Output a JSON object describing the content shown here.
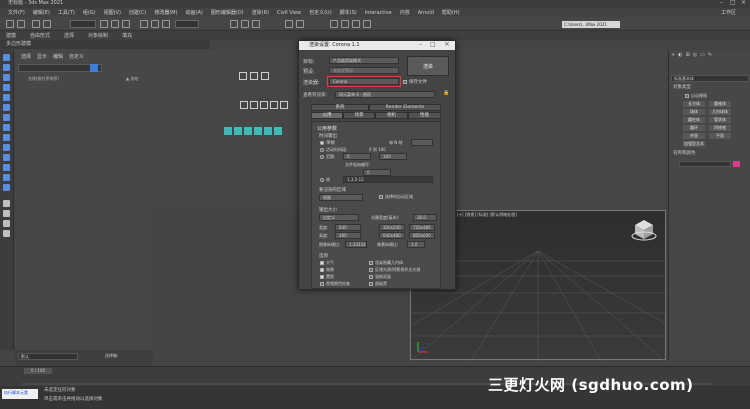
{
  "window": {
    "title": "无标题 - 3ds Max 2021"
  },
  "menu": [
    "文件(F)",
    "编辑(E)",
    "工具(T)",
    "组(G)",
    "视图(V)",
    "创建(C)",
    "修改器(M)",
    "动画(A)",
    "图形编辑器(D)",
    "渲染(R)",
    "Civil View",
    "自定义(U)",
    "脚本(S)",
    "Interactive",
    "内容",
    "Arnold",
    "帮助(H)"
  ],
  "toolbar": {
    "workspace": "工作区",
    "workspace_path": "C:\\Users\\...\\Max 2021"
  },
  "ribbon": {
    "items": [
      "建模",
      "自由形式",
      "选择",
      "对象绘制",
      "填充"
    ],
    "sub": "多边形建模"
  },
  "scene_explorer": {
    "tabs": [
      "选择",
      "显示",
      "编辑",
      "自定义"
    ],
    "search_placeholder": "名称(按升序排序)",
    "column": "▲ 冻结",
    "layer_label": "默认",
    "selection_set": "选择集:"
  },
  "dialog": {
    "title": "渲染设置: Corona 1.1",
    "target_label": "目标:",
    "target_value": "产品级渲染模式",
    "preset_label": "预设:",
    "preset_value": "未选定预设",
    "renderer_label": "渲染器:",
    "renderer_value": "Corona",
    "save_file": "保存文件",
    "render_button": "渲染",
    "view_label": "查看到渲染:",
    "view_value": "四元菜单 4 - 透视",
    "tabs_row1": [
      "系统",
      "Render Elements"
    ],
    "tabs_row2": [
      "公用",
      "场景",
      "相机",
      "性能"
    ],
    "section_common": "公用参数",
    "time_output": "时间输出",
    "single": "单帧",
    "every_nth": "每 N 帧",
    "active_segment": "活动时间段:",
    "active_range": "0 到 100",
    "range": "范围:",
    "range_from": "0",
    "range_to": "100",
    "file_number_base": "文件起始编号:",
    "file_number_value": "0",
    "frames": "帧",
    "frames_value": "1,3,5-12",
    "area_to_render": "要渲染的区域",
    "area_value": "视图",
    "auto_region": "选择的自动区域",
    "output_size": "输出大小",
    "custom": "自定义",
    "aperture": "光圈宽度(毫米):",
    "aperture_value": "36.0",
    "width_label": "宽度:",
    "width_value": "640",
    "height_label": "高度:",
    "height_value": "480",
    "size_buttons": [
      "320x240",
      "720x486",
      "640x480",
      "800x600"
    ],
    "pixel_aspect_label": "图像纵横比:",
    "pixel_aspect_value": "1.33333",
    "pixel_ratio_label": "像素纵横比:",
    "pixel_ratio_value": "1.0",
    "options": "选项",
    "option_items": [
      "大气",
      "效果",
      "置换",
      "视频颜色检查"
    ],
    "option_items_right": [
      "渲染隐藏几何体",
      "区域光源/阴影视作点光源",
      "强制双面",
      "超级黑"
    ]
  },
  "right_panel": {
    "title": "标准基本体",
    "object_type": "对象类型",
    "auto_grid": "自动栅格",
    "buttons": [
      "长方体",
      "圆锥体",
      "球体",
      "几何球体",
      "圆柱体",
      "管状体",
      "圆环",
      "四棱锥",
      "茶壶",
      "平面",
      "加强型文本"
    ],
    "name_color": "名称和颜色"
  },
  "viewport": {
    "label": "[+] [透视] [标准] [默认明暗处理]"
  },
  "timeline": {
    "frame_counter": "0 / 100"
  },
  "status": {
    "line1": "未选定任何对象",
    "line2": "单击或单击并拖动以选择对象",
    "script_hint": "执行脚本元素"
  },
  "watermark": "三更灯火网 (sgdhuo.com)"
}
